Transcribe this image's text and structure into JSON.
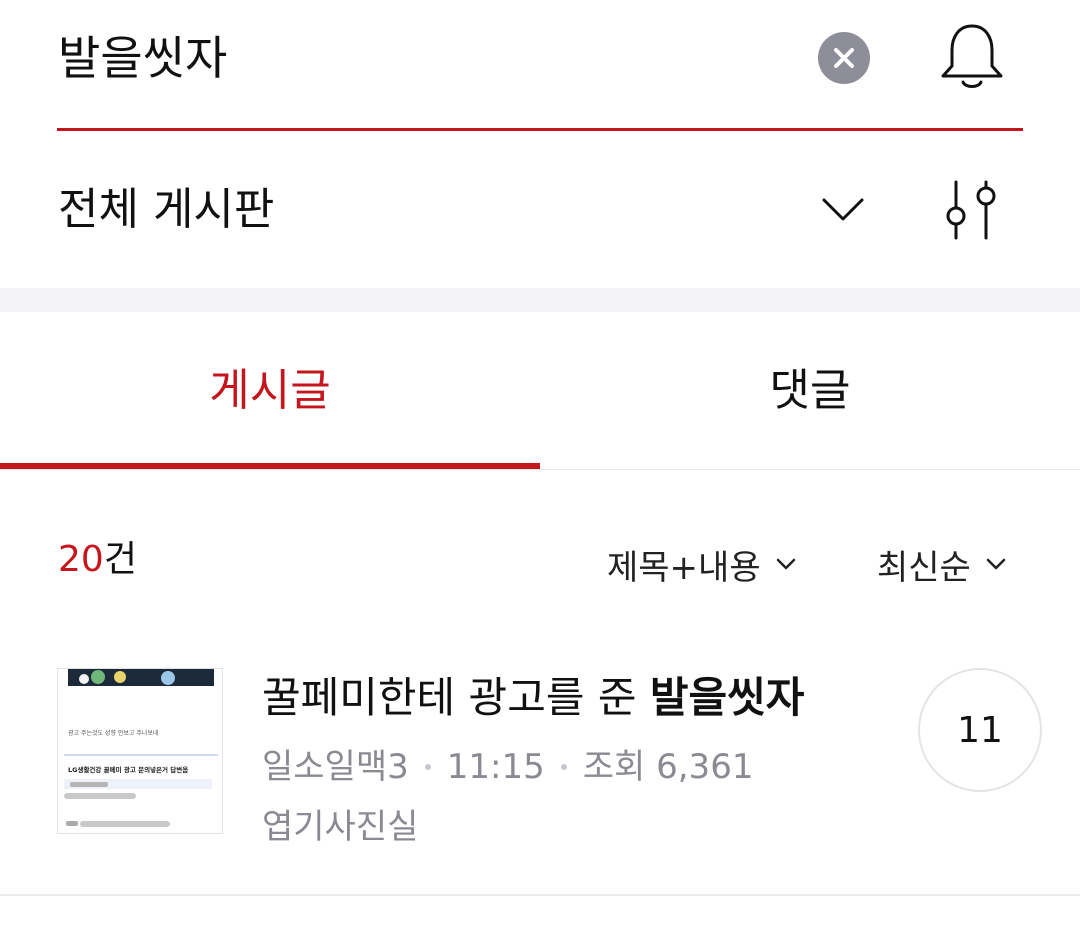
{
  "search": {
    "query": "발을씻자"
  },
  "board_filter": {
    "label": "전체 게시판"
  },
  "tabs": [
    {
      "label": "게시글",
      "active": true
    },
    {
      "label": "댓글",
      "active": false
    }
  ],
  "results": {
    "count": "20",
    "count_suffix": "건",
    "scope_label": "제목+내용",
    "order_label": "최신순"
  },
  "posts": [
    {
      "title_prefix": "꿀페미한테 광고를 준 ",
      "title_highlight": "발을씻자",
      "author": "일소일맥3",
      "time": "11:15",
      "views": "조회 6,361",
      "board": "엽기사진실",
      "comments": "11",
      "thumbnail": {
        "caption_line": "광고 주는것도 성향 안보고 주나보네",
        "headline": "LG생활건강 꿀페미 광고 문의넣은거 답변옴"
      }
    }
  ],
  "colors": {
    "accent": "#c4161c",
    "muted_text": "#8a8a92",
    "clear_button": "#8e8e99",
    "band": "#f4f4f7"
  },
  "icons": {
    "clear": "close-circle-icon",
    "notifications": "bell-icon",
    "board_dropdown": "chevron-down-icon",
    "filter": "slider-filter-icon"
  }
}
